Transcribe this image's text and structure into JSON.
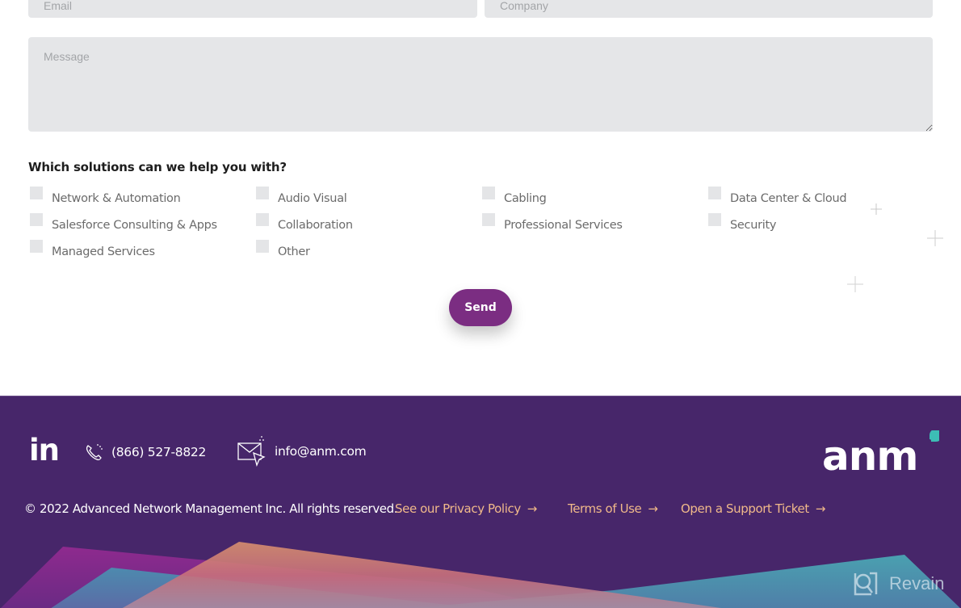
{
  "form": {
    "email_placeholder": "Email",
    "company_placeholder": "Company",
    "message_placeholder": "Message",
    "email_value": "",
    "company_value": "",
    "message_value": "",
    "question": "Which solutions can we help you with?",
    "solutions": [
      {
        "label": "Network & Automation",
        "checked": false
      },
      {
        "label": "Audio Visual",
        "checked": false
      },
      {
        "label": "Cabling",
        "checked": false
      },
      {
        "label": "Data Center & Cloud",
        "checked": false
      },
      {
        "label": "Salesforce Consulting & Apps",
        "checked": false
      },
      {
        "label": "Collaboration",
        "checked": false
      },
      {
        "label": "Professional Services",
        "checked": false
      },
      {
        "label": "Security",
        "checked": false
      },
      {
        "label": "Managed Services",
        "checked": false
      },
      {
        "label": "Other",
        "checked": false
      }
    ],
    "send_label": "Send"
  },
  "footer": {
    "linkedin_label": "in",
    "phone": "(866) 527-8822",
    "email": "info@anm.com",
    "logo_text": "anm",
    "copyright": "© 2022 Advanced Network Management Inc. All rights reserved.",
    "links": [
      {
        "label": "See our Privacy Policy",
        "arrow": "→"
      },
      {
        "label": "Terms of Use",
        "arrow": "→"
      },
      {
        "label": "Open a Support Ticket",
        "arrow": "→"
      }
    ],
    "watermark": "Revain"
  },
  "colors": {
    "accent": "#7b2d82",
    "footer_bg": "#47266a",
    "link": "#f0b98a",
    "logo_dot": "#3dbdb5",
    "field_bg": "#e5e6e8"
  }
}
